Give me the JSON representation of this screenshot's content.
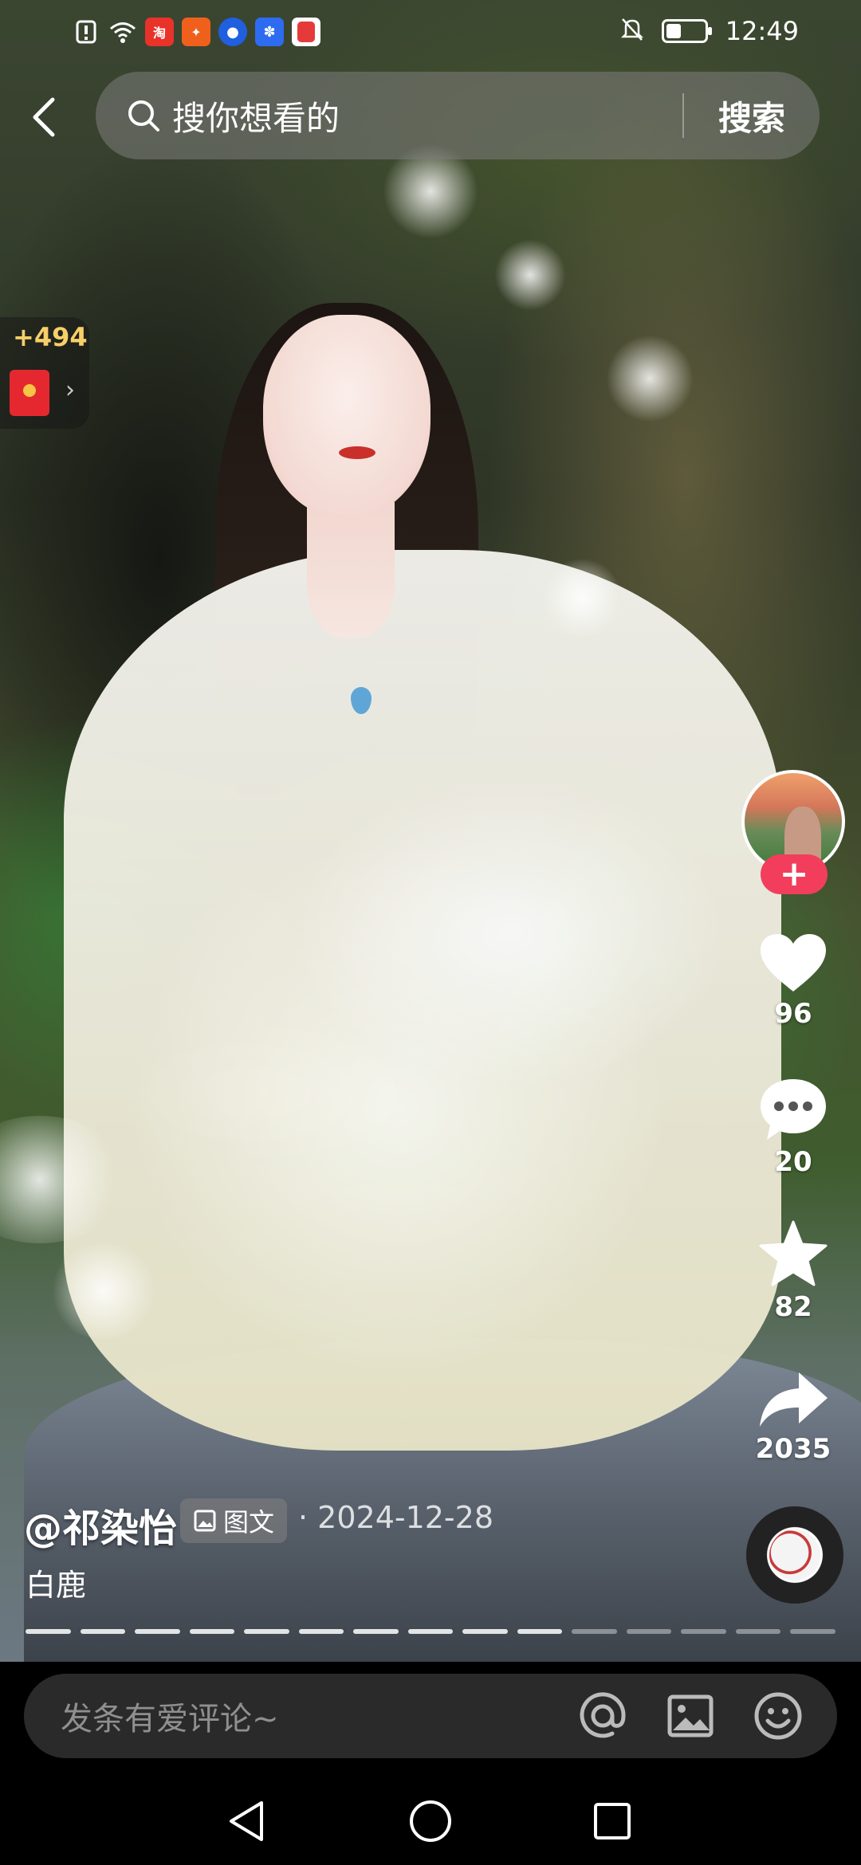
{
  "status_bar": {
    "time": "12:49",
    "icons": [
      "alert-icon",
      "wifi-icon",
      "app-icon-taobao",
      "app-icon-game",
      "app-icon-blue",
      "app-icon-baidu",
      "app-icon-red"
    ],
    "right_icons": [
      "silent-icon",
      "battery-icon"
    ]
  },
  "search": {
    "placeholder": "搜你想看的",
    "button_label": "搜索"
  },
  "reward": {
    "count": "+494"
  },
  "actions": {
    "like_count": "96",
    "comment_count": "20",
    "favorite_count": "82",
    "share_count": "2035"
  },
  "post": {
    "author": "@祁染怡",
    "type_label": "图文",
    "date": "· 2024-12-28",
    "description": "白鹿",
    "progress": {
      "total_images": 15,
      "current_index": 10
    }
  },
  "comment": {
    "placeholder": "发条有爱评论~"
  },
  "colors": {
    "accent": "#f23e5c",
    "comment_bar": "#2a2a2a",
    "reward_text": "#f7cf6a"
  }
}
